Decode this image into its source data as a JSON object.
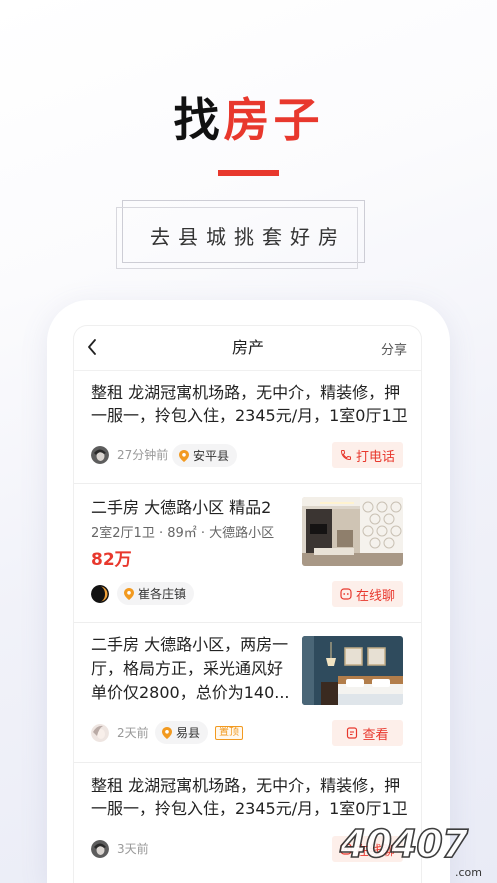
{
  "hero": {
    "title_black": "找",
    "title_red": "房子",
    "subtitle": "去县城挑套好房"
  },
  "colors": {
    "accent": "#e8382d",
    "pin": "#f29a20",
    "action_bg": "#fdefea"
  },
  "app": {
    "back_icon": "chevron-left-icon",
    "title": "房产",
    "share_label": "分享"
  },
  "listings": [
    {
      "lines": [
        "整租 龙湖冠寓机场路，无中介，精装修，押",
        "一服一，拎包入住，2345元/月，1室0厅1卫"
      ],
      "time": "27分钟前",
      "location": "安平县",
      "action": "打电话",
      "action_icon": "phone-icon"
    },
    {
      "title": "二手房 大德路小区 精品2",
      "details": "2室2厅1卫 · 89㎡ · 大德路小区",
      "price": "82万",
      "location": "崔各庄镇",
      "action": "在线聊",
      "action_icon": "chat-icon"
    },
    {
      "lines": [
        "二手房 大德路小区，两房一",
        "厅，格局方正，采光通风好",
        "单价仅2800，总价为140..."
      ],
      "time": "2天前",
      "location": "易县",
      "badge": "置顶",
      "action": "查看",
      "action_icon": "document-icon"
    },
    {
      "lines": [
        "整租 龙湖冠寓机场路，无中介，精装修，押",
        "一服一，拎包入住，2345元/月，1室0厅1卫"
      ],
      "time": "3天前",
      "action": "在线聊",
      "action_icon": "chat-icon"
    }
  ],
  "watermark": {
    "logo": "40407",
    "suffix": ".com"
  }
}
